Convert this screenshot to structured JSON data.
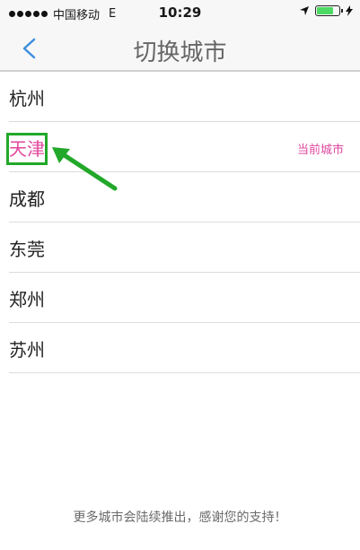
{
  "status_bar": {
    "carrier": "中国移动",
    "network": "E",
    "time": "10:29",
    "battery_level": 0.8,
    "battery_color": "#4cd964"
  },
  "nav": {
    "title": "切换城市",
    "back_icon": "chevron-left-icon",
    "accent_color": "#3d8fe0"
  },
  "cities": [
    {
      "name": "杭州",
      "current": false
    },
    {
      "name": "天津",
      "current": true
    },
    {
      "name": "成都",
      "current": false
    },
    {
      "name": "东莞",
      "current": false
    },
    {
      "name": "郑州",
      "current": false
    },
    {
      "name": "苏州",
      "current": false
    }
  ],
  "current_city_label": "当前城市",
  "highlight_color": "#e0479d",
  "annotation_color": "#22a82a",
  "footer": {
    "note": "更多城市会陆续推出，感谢您的支持！"
  }
}
